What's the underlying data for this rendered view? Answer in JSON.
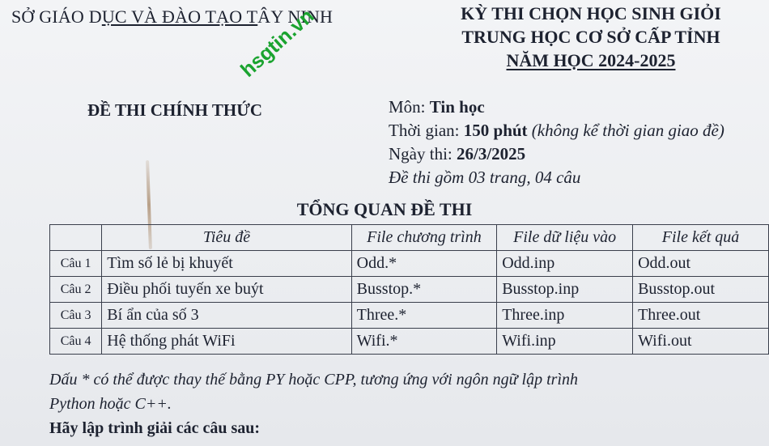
{
  "header": {
    "department_prefix": "SỞ GIÁO D",
    "department_underlined": "ỤC VÀ ĐÀO TẠO T",
    "department_suffix": "ÂY NINH",
    "exam_line1": "KỲ THI CHỌN HỌC SINH GIỎI",
    "exam_line2": "TRUNG HỌC CƠ SỞ CẤP TỈNH",
    "exam_line3": "NĂM HỌC 2024-2025",
    "watermark": "hsgtin.vn"
  },
  "official_label": "ĐỀ THI CHÍNH THỨC",
  "meta": {
    "subject_label": "Môn: ",
    "subject_value": "Tin học",
    "time_label": "Thời gian: ",
    "time_value": "150 phút",
    "time_note": " (không kể thời gian giao đề)",
    "date_label": "Ngày thi: ",
    "date_value": "26/3/2025",
    "pages_note": "Đề thi gồm 03 trang, 04 câu"
  },
  "overview": {
    "title": "TỔNG QUAN ĐỀ THI",
    "headers": [
      "Tiêu đề",
      "File chương trình",
      "File dữ liệu vào",
      "File kết quả"
    ],
    "rows": [
      {
        "num": "Câu 1",
        "title": "Tìm số lẻ bị khuyết",
        "program": "Odd.*",
        "input": "Odd.inp",
        "output": "Odd.out"
      },
      {
        "num": "Câu 2",
        "title": "Điều phối tuyến xe buýt",
        "program": "Busstop.*",
        "input": "Busstop.inp",
        "output": "Busstop.out"
      },
      {
        "num": "Câu 3",
        "title": "Bí ẩn của số 3",
        "program": "Three.*",
        "input": "Three.inp",
        "output": "Three.out"
      },
      {
        "num": "Câu 4",
        "title": "Hệ thống phát WiFi",
        "program": "Wifi.*",
        "input": "Wifi.inp",
        "output": "Wifi.out"
      }
    ]
  },
  "note_line1": "Dấu * có thể được thay thế bằng PY hoặc CPP, tương ứng với ngôn ngữ lập trình",
  "note_line2": "Python hoặc C++.",
  "task_heading": "Hãy lập trình giải các câu sau:"
}
